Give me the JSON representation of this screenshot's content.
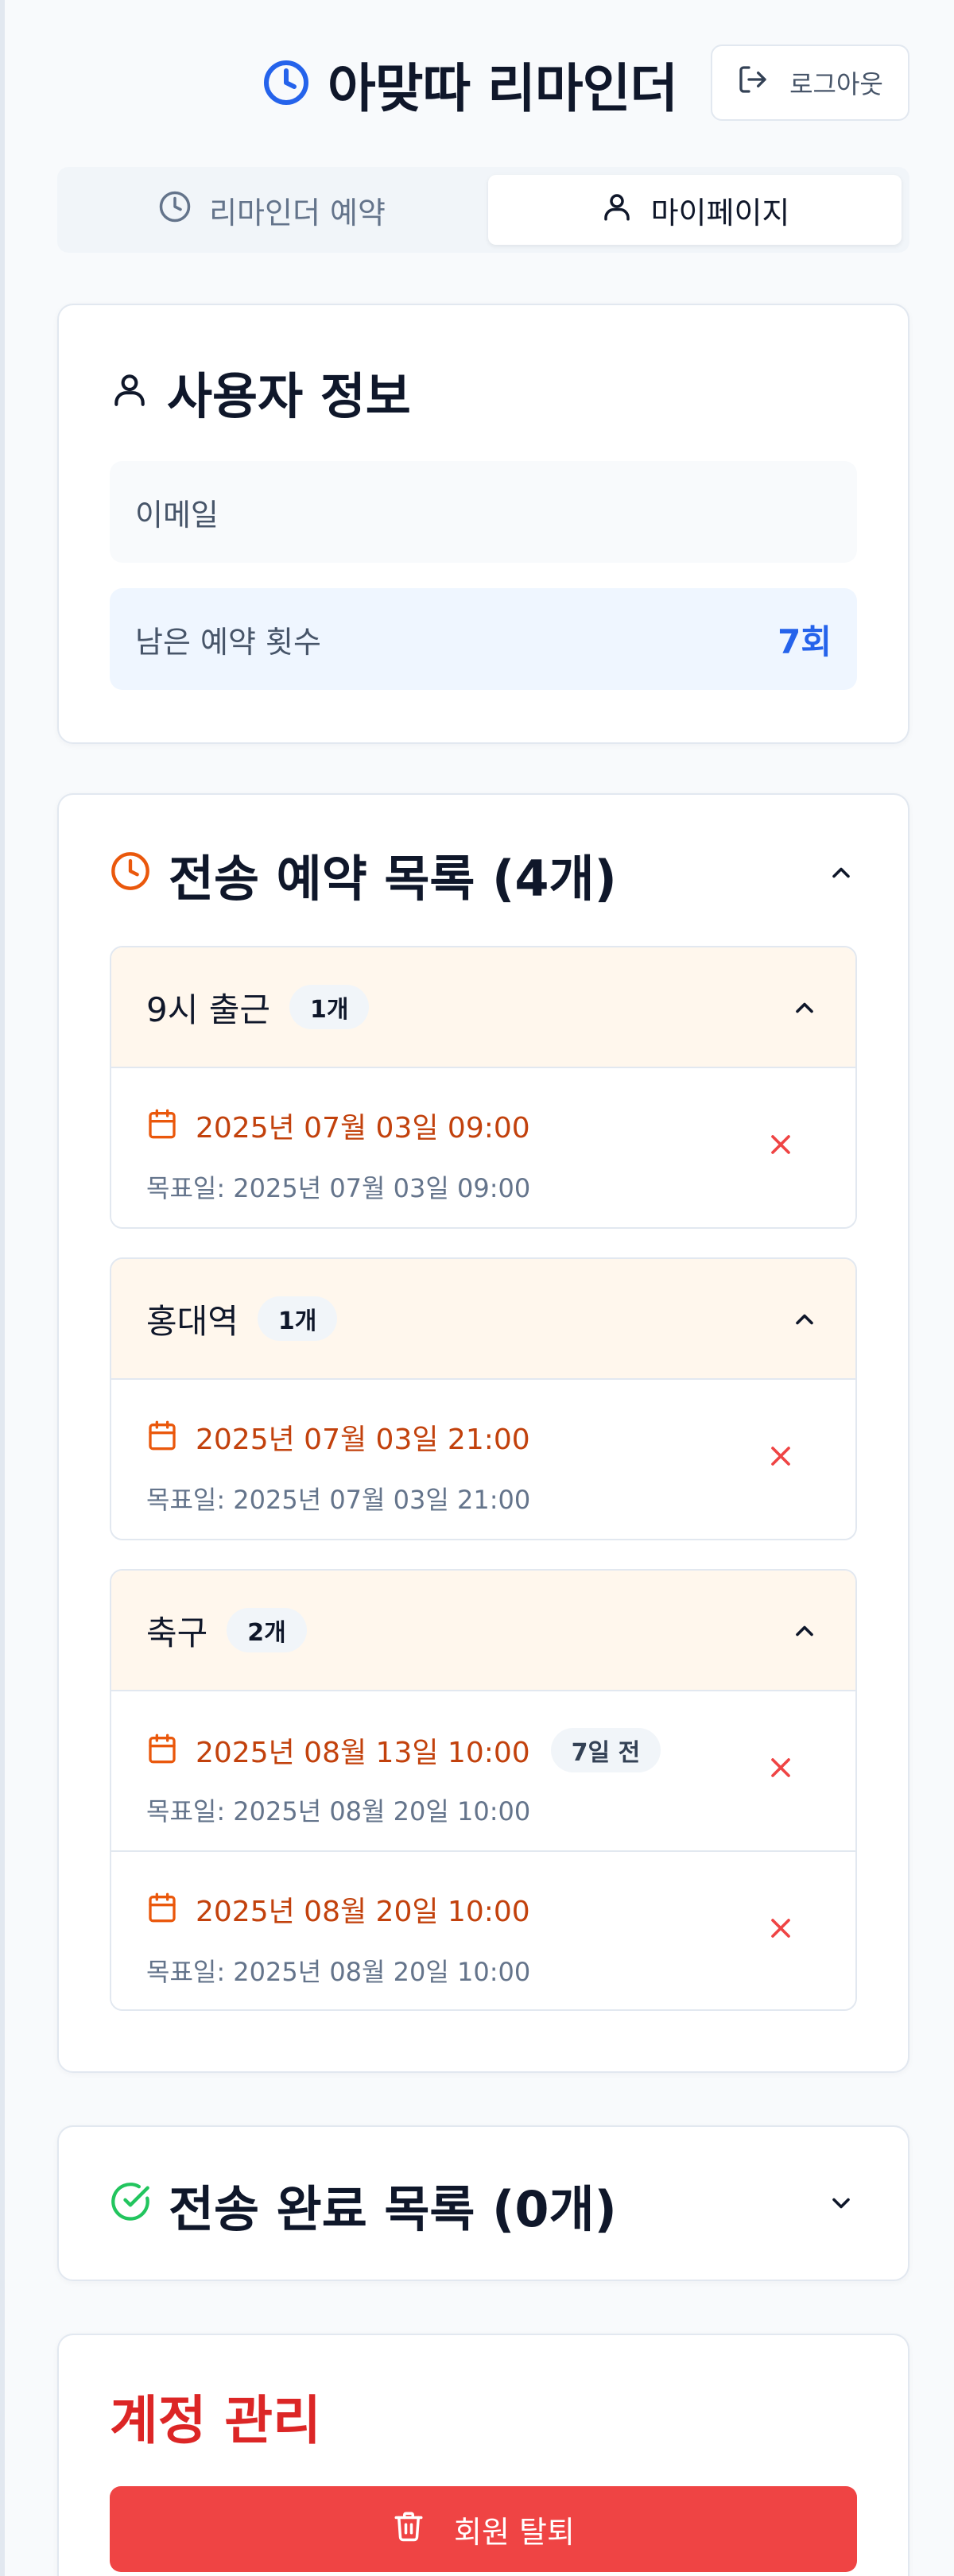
{
  "header": {
    "title": "아맞따 리마인더",
    "logout_label": "로그아웃"
  },
  "tabs": [
    {
      "label": "리마인더 예약",
      "icon": "clock-icon",
      "active": false
    },
    {
      "label": "마이페이지",
      "icon": "user-icon",
      "active": true
    }
  ],
  "user_info": {
    "title": "사용자 정보",
    "email_label": "이메일",
    "remaining_label": "남은 예약 횟수",
    "remaining_value": "7회"
  },
  "scheduled": {
    "title": "전송 예약 목록 (4개)",
    "groups": [
      {
        "name": "9시 출근",
        "count": "1개",
        "items": [
          {
            "date": "2025년 07월 03일 09:00",
            "badge": "",
            "target": "목표일: 2025년 07월 03일 09:00"
          }
        ]
      },
      {
        "name": "홍대역",
        "count": "1개",
        "items": [
          {
            "date": "2025년 07월 03일 21:00",
            "badge": "",
            "target": "목표일: 2025년 07월 03일 21:00"
          }
        ]
      },
      {
        "name": "축구",
        "count": "2개",
        "items": [
          {
            "date": "2025년 08월 13일 10:00",
            "badge": "7일 전",
            "target": "목표일: 2025년 08월 20일 10:00"
          },
          {
            "date": "2025년 08월 20일 10:00",
            "badge": "",
            "target": "목표일: 2025년 08월 20일 10:00"
          }
        ]
      }
    ]
  },
  "completed": {
    "title": "전송 완료 목록 (0개)"
  },
  "account": {
    "title": "계정 관리",
    "withdraw_label": "회원 탈퇴"
  },
  "colors": {
    "primary": "#2563eb",
    "accent_orange": "#ea580c",
    "success": "#22c55e",
    "danger": "#ef4444"
  }
}
